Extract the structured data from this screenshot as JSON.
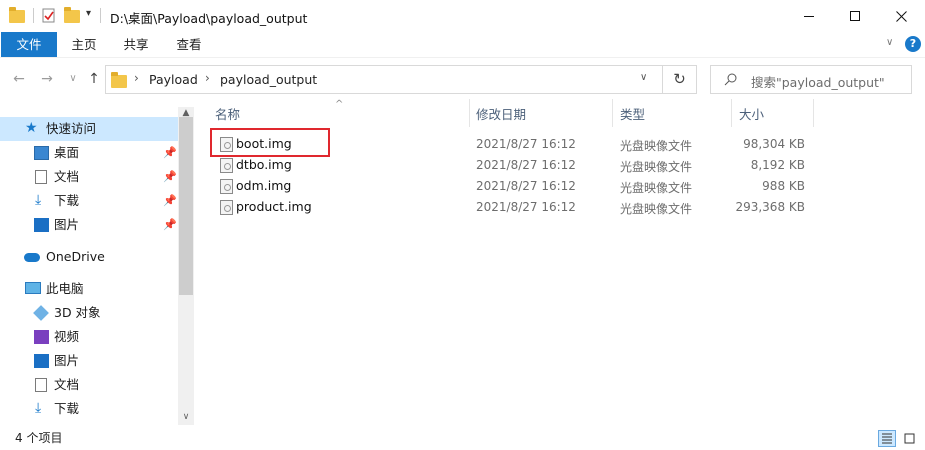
{
  "title_bar": {
    "path": "D:\\桌面\\Payload\\payload_output",
    "minimize_icon": "minimize-icon",
    "maximize_icon": "maximize-icon",
    "close_icon": "close-icon"
  },
  "ribbon": {
    "tabs": [
      {
        "label": "文件"
      },
      {
        "label": "主页"
      },
      {
        "label": "共享"
      },
      {
        "label": "查看"
      }
    ],
    "accent": "#1979ca"
  },
  "address": {
    "crumbs": [
      "Payload",
      "payload_output"
    ],
    "search_placeholder": "搜索\"payload_output\""
  },
  "nav": {
    "quick_access": "快速访问",
    "quick_items": [
      {
        "label": "桌面",
        "icon": "desktop-icon"
      },
      {
        "label": "文档",
        "icon": "documents-icon"
      },
      {
        "label": "下载",
        "icon": "downloads-icon"
      },
      {
        "label": "图片",
        "icon": "pictures-icon"
      }
    ],
    "onedrive": "OneDrive",
    "this_pc": "此电脑",
    "pc_items": [
      {
        "label": "3D 对象",
        "icon": "3d-objects-icon"
      },
      {
        "label": "视频",
        "icon": "videos-icon"
      },
      {
        "label": "图片",
        "icon": "pictures-icon"
      },
      {
        "label": "文档",
        "icon": "documents-icon"
      },
      {
        "label": "下载",
        "icon": "downloads-icon"
      }
    ]
  },
  "columns": {
    "name": "名称",
    "date": "修改日期",
    "type": "类型",
    "size": "大小"
  },
  "files": [
    {
      "name": "boot.img",
      "date": "2021/8/27 16:12",
      "type": "光盘映像文件",
      "size": "98,304 KB"
    },
    {
      "name": "dtbo.img",
      "date": "2021/8/27 16:12",
      "type": "光盘映像文件",
      "size": "8,192 KB"
    },
    {
      "name": "odm.img",
      "date": "2021/8/27 16:12",
      "type": "光盘映像文件",
      "size": "988 KB"
    },
    {
      "name": "product.img",
      "date": "2021/8/27 16:12",
      "type": "光盘映像文件",
      "size": "293,368 KB"
    }
  ],
  "highlight_color": "#e0282e",
  "status": {
    "item_count": "4 个项目"
  }
}
